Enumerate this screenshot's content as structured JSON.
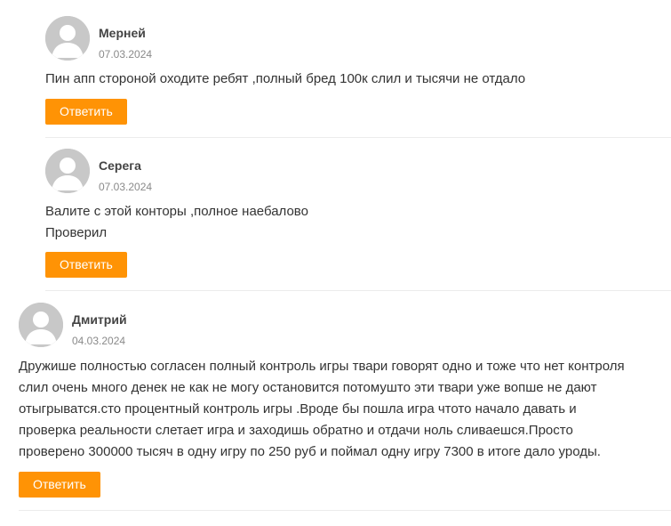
{
  "comments": [
    {
      "author": "Мерней",
      "date": "07.03.2024",
      "lines": [
        "Пин апп стороной оходите ребят ,полный бред 100к слил и тысячи не отдало"
      ],
      "reply_label": "Ответить"
    },
    {
      "author": "Серега",
      "date": "07.03.2024",
      "lines": [
        "Валите с этой конторы ,полное наебалово",
        "Проверил"
      ],
      "reply_label": "Ответить"
    },
    {
      "author": "Дмитрий",
      "date": "04.03.2024",
      "lines": [
        "Дружише полностью согласен полный контроль игры твари говорят одно и тоже что нет контроля",
        "слил очень много денек не как не могу остановится потомушто эти твари уже вопше не дают",
        "отыгрыватся.сто процентный контроль игры .Вроде бы пошла игра чтото начало давать и",
        "проверка реальности слетает игра и заходишь обратно и отдачи ноль сливаешся.Просто",
        "проверено 300000 тысяч в одну игру по 250 руб и поймал одну игру 7300 в итоге дало уроды."
      ],
      "reply_label": "Ответить"
    }
  ],
  "icons": {
    "avatar": "default-user-avatar-icon"
  },
  "colors": {
    "reply_button": "#ff9305",
    "avatar_bg": "#c8c8c8",
    "divider": "#ececec",
    "date": "#8a8a8a"
  }
}
